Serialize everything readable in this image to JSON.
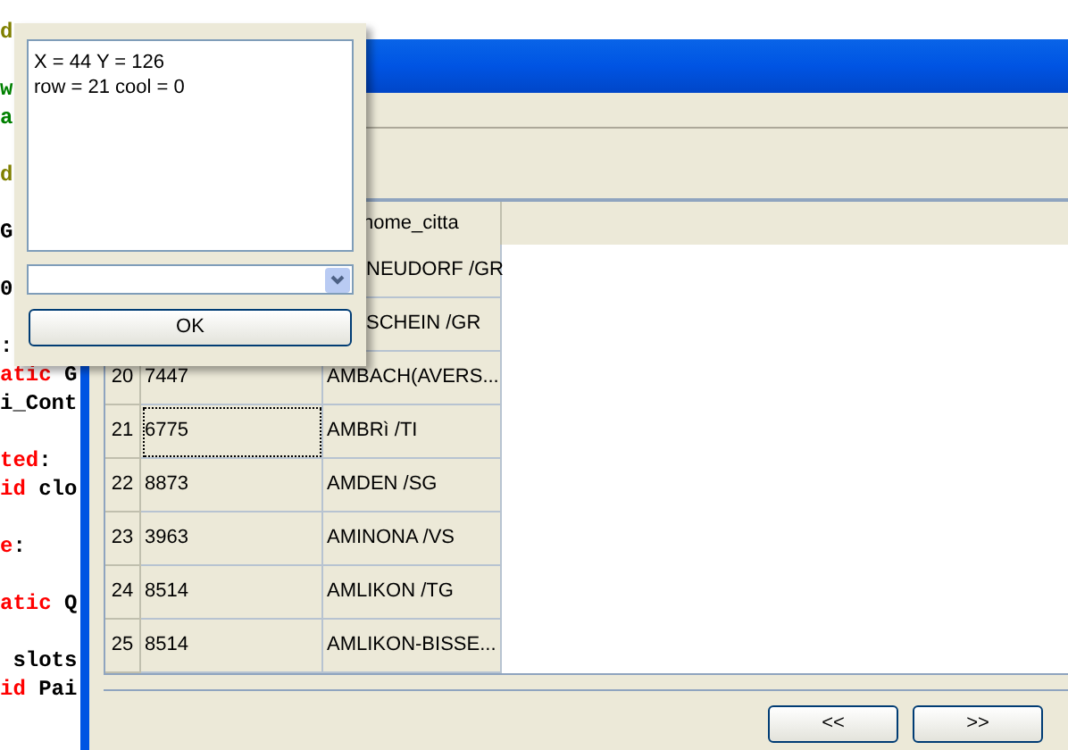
{
  "code_editor": {
    "lines": [
      {
        "segments": [
          {
            "text": "d",
            "color": "#808000"
          }
        ]
      },
      {
        "segments": [
          {
            "text": "w",
            "color": "#008000"
          }
        ]
      },
      {
        "segments": [
          {
            "text": "a",
            "color": "#008000"
          }
        ]
      },
      {
        "segments": [
          {
            "text": "d",
            "color": "#808000"
          }
        ]
      },
      {
        "segments": [
          {
            "text": "G",
            "color": "#000000"
          }
        ]
      },
      {
        "segments": [
          {
            "text": "0",
            "color": "#000000"
          }
        ]
      },
      {
        "segments": [
          {
            "text": ":",
            "color": "#000000"
          }
        ]
      },
      {
        "segments": [
          {
            "text": "atic",
            "color": "#ff0000"
          },
          {
            "text": " G",
            "color": "#000000"
          }
        ]
      },
      {
        "segments": [
          {
            "text": "i_Cont",
            "color": "#000000"
          }
        ]
      },
      {
        "segments": [
          {
            "text": "ted",
            "color": "#ff0000"
          },
          {
            "text": ":",
            "color": "#000000"
          }
        ]
      },
      {
        "segments": [
          {
            "text": "id",
            "color": "#ff0000"
          },
          {
            "text": " clo",
            "color": "#000000"
          }
        ]
      },
      {
        "segments": [
          {
            "text": "e",
            "color": "#ff0000"
          },
          {
            "text": ":",
            "color": "#000000"
          }
        ]
      },
      {
        "segments": [
          {
            "text": "atic",
            "color": "#ff0000"
          },
          {
            "text": " Q",
            "color": "#000000"
          }
        ]
      },
      {
        "segments": [
          {
            "text": " slots",
            "color": "#000000"
          }
        ]
      },
      {
        "segments": [
          {
            "text": "id",
            "color": "#ff0000"
          },
          {
            "text": " Pai",
            "color": "#000000"
          }
        ]
      }
    ]
  },
  "table": {
    "columns": [
      "nome_citta"
    ],
    "rows": [
      {
        "cells": [
          {
            "text": "NEUDORF /GR",
            "focused": false
          }
        ]
      },
      {
        "cells": [
          {
            "text": "SCHEIN /GR",
            "focused": false
          }
        ]
      },
      {
        "number": "20",
        "cells": [
          {
            "text": "7447",
            "focused": false
          },
          {
            "text": "AMBACH(AVERS...",
            "focused": false
          }
        ]
      },
      {
        "number": "21",
        "cells": [
          {
            "text": "6775",
            "focused": true
          },
          {
            "text": "AMBRì /TI",
            "focused": false
          }
        ]
      },
      {
        "number": "22",
        "cells": [
          {
            "text": "8873",
            "focused": false
          },
          {
            "text": "AMDEN /SG",
            "focused": false
          }
        ]
      },
      {
        "number": "23",
        "cells": [
          {
            "text": "3963",
            "focused": false
          },
          {
            "text": "AMINONA /VS",
            "focused": false
          }
        ]
      },
      {
        "number": "24",
        "cells": [
          {
            "text": "8514",
            "focused": false
          },
          {
            "text": "AMLIKON /TG",
            "focused": false
          }
        ]
      },
      {
        "number": "25",
        "cells": [
          {
            "text": "8514",
            "focused": false
          },
          {
            "text": "AMLIKON-BISSE...",
            "focused": false
          }
        ]
      }
    ]
  },
  "buttons": [
    "<<",
    ">>"
  ],
  "dialog": {
    "text_lines": [
      "X = 44 Y = 126",
      "row = 21 cool = 0"
    ],
    "button": "OK"
  }
}
